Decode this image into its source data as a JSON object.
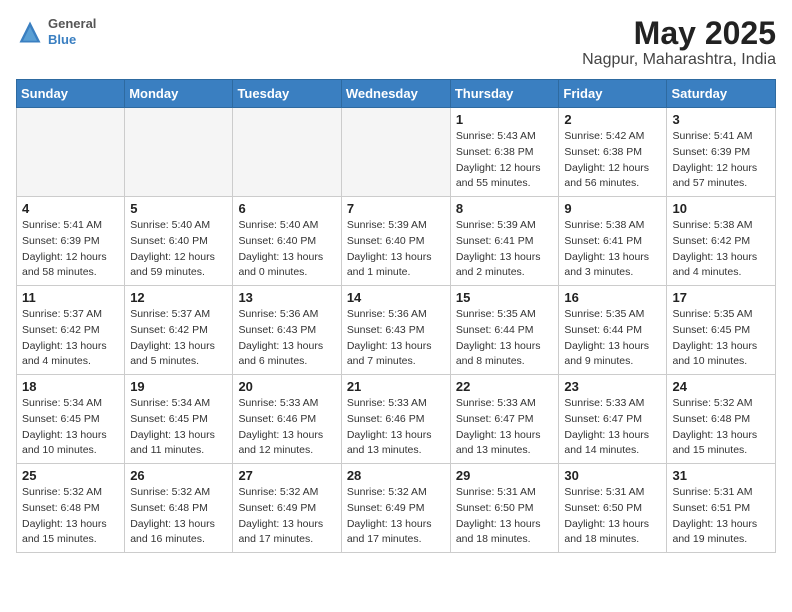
{
  "header": {
    "logo_line1": "General",
    "logo_line2": "Blue",
    "title": "May 2025",
    "subtitle": "Nagpur, Maharashtra, India"
  },
  "calendar": {
    "days_of_week": [
      "Sunday",
      "Monday",
      "Tuesday",
      "Wednesday",
      "Thursday",
      "Friday",
      "Saturday"
    ],
    "weeks": [
      [
        {
          "day": "",
          "info": ""
        },
        {
          "day": "",
          "info": ""
        },
        {
          "day": "",
          "info": ""
        },
        {
          "day": "",
          "info": ""
        },
        {
          "day": "1",
          "info": "Sunrise: 5:43 AM\nSunset: 6:38 PM\nDaylight: 12 hours\nand 55 minutes."
        },
        {
          "day": "2",
          "info": "Sunrise: 5:42 AM\nSunset: 6:38 PM\nDaylight: 12 hours\nand 56 minutes."
        },
        {
          "day": "3",
          "info": "Sunrise: 5:41 AM\nSunset: 6:39 PM\nDaylight: 12 hours\nand 57 minutes."
        }
      ],
      [
        {
          "day": "4",
          "info": "Sunrise: 5:41 AM\nSunset: 6:39 PM\nDaylight: 12 hours\nand 58 minutes."
        },
        {
          "day": "5",
          "info": "Sunrise: 5:40 AM\nSunset: 6:40 PM\nDaylight: 12 hours\nand 59 minutes."
        },
        {
          "day": "6",
          "info": "Sunrise: 5:40 AM\nSunset: 6:40 PM\nDaylight: 13 hours\nand 0 minutes."
        },
        {
          "day": "7",
          "info": "Sunrise: 5:39 AM\nSunset: 6:40 PM\nDaylight: 13 hours\nand 1 minute."
        },
        {
          "day": "8",
          "info": "Sunrise: 5:39 AM\nSunset: 6:41 PM\nDaylight: 13 hours\nand 2 minutes."
        },
        {
          "day": "9",
          "info": "Sunrise: 5:38 AM\nSunset: 6:41 PM\nDaylight: 13 hours\nand 3 minutes."
        },
        {
          "day": "10",
          "info": "Sunrise: 5:38 AM\nSunset: 6:42 PM\nDaylight: 13 hours\nand 4 minutes."
        }
      ],
      [
        {
          "day": "11",
          "info": "Sunrise: 5:37 AM\nSunset: 6:42 PM\nDaylight: 13 hours\nand 4 minutes."
        },
        {
          "day": "12",
          "info": "Sunrise: 5:37 AM\nSunset: 6:42 PM\nDaylight: 13 hours\nand 5 minutes."
        },
        {
          "day": "13",
          "info": "Sunrise: 5:36 AM\nSunset: 6:43 PM\nDaylight: 13 hours\nand 6 minutes."
        },
        {
          "day": "14",
          "info": "Sunrise: 5:36 AM\nSunset: 6:43 PM\nDaylight: 13 hours\nand 7 minutes."
        },
        {
          "day": "15",
          "info": "Sunrise: 5:35 AM\nSunset: 6:44 PM\nDaylight: 13 hours\nand 8 minutes."
        },
        {
          "day": "16",
          "info": "Sunrise: 5:35 AM\nSunset: 6:44 PM\nDaylight: 13 hours\nand 9 minutes."
        },
        {
          "day": "17",
          "info": "Sunrise: 5:35 AM\nSunset: 6:45 PM\nDaylight: 13 hours\nand 10 minutes."
        }
      ],
      [
        {
          "day": "18",
          "info": "Sunrise: 5:34 AM\nSunset: 6:45 PM\nDaylight: 13 hours\nand 10 minutes."
        },
        {
          "day": "19",
          "info": "Sunrise: 5:34 AM\nSunset: 6:45 PM\nDaylight: 13 hours\nand 11 minutes."
        },
        {
          "day": "20",
          "info": "Sunrise: 5:33 AM\nSunset: 6:46 PM\nDaylight: 13 hours\nand 12 minutes."
        },
        {
          "day": "21",
          "info": "Sunrise: 5:33 AM\nSunset: 6:46 PM\nDaylight: 13 hours\nand 13 minutes."
        },
        {
          "day": "22",
          "info": "Sunrise: 5:33 AM\nSunset: 6:47 PM\nDaylight: 13 hours\nand 13 minutes."
        },
        {
          "day": "23",
          "info": "Sunrise: 5:33 AM\nSunset: 6:47 PM\nDaylight: 13 hours\nand 14 minutes."
        },
        {
          "day": "24",
          "info": "Sunrise: 5:32 AM\nSunset: 6:48 PM\nDaylight: 13 hours\nand 15 minutes."
        }
      ],
      [
        {
          "day": "25",
          "info": "Sunrise: 5:32 AM\nSunset: 6:48 PM\nDaylight: 13 hours\nand 15 minutes."
        },
        {
          "day": "26",
          "info": "Sunrise: 5:32 AM\nSunset: 6:48 PM\nDaylight: 13 hours\nand 16 minutes."
        },
        {
          "day": "27",
          "info": "Sunrise: 5:32 AM\nSunset: 6:49 PM\nDaylight: 13 hours\nand 17 minutes."
        },
        {
          "day": "28",
          "info": "Sunrise: 5:32 AM\nSunset: 6:49 PM\nDaylight: 13 hours\nand 17 minutes."
        },
        {
          "day": "29",
          "info": "Sunrise: 5:31 AM\nSunset: 6:50 PM\nDaylight: 13 hours\nand 18 minutes."
        },
        {
          "day": "30",
          "info": "Sunrise: 5:31 AM\nSunset: 6:50 PM\nDaylight: 13 hours\nand 18 minutes."
        },
        {
          "day": "31",
          "info": "Sunrise: 5:31 AM\nSunset: 6:51 PM\nDaylight: 13 hours\nand 19 minutes."
        }
      ]
    ]
  }
}
